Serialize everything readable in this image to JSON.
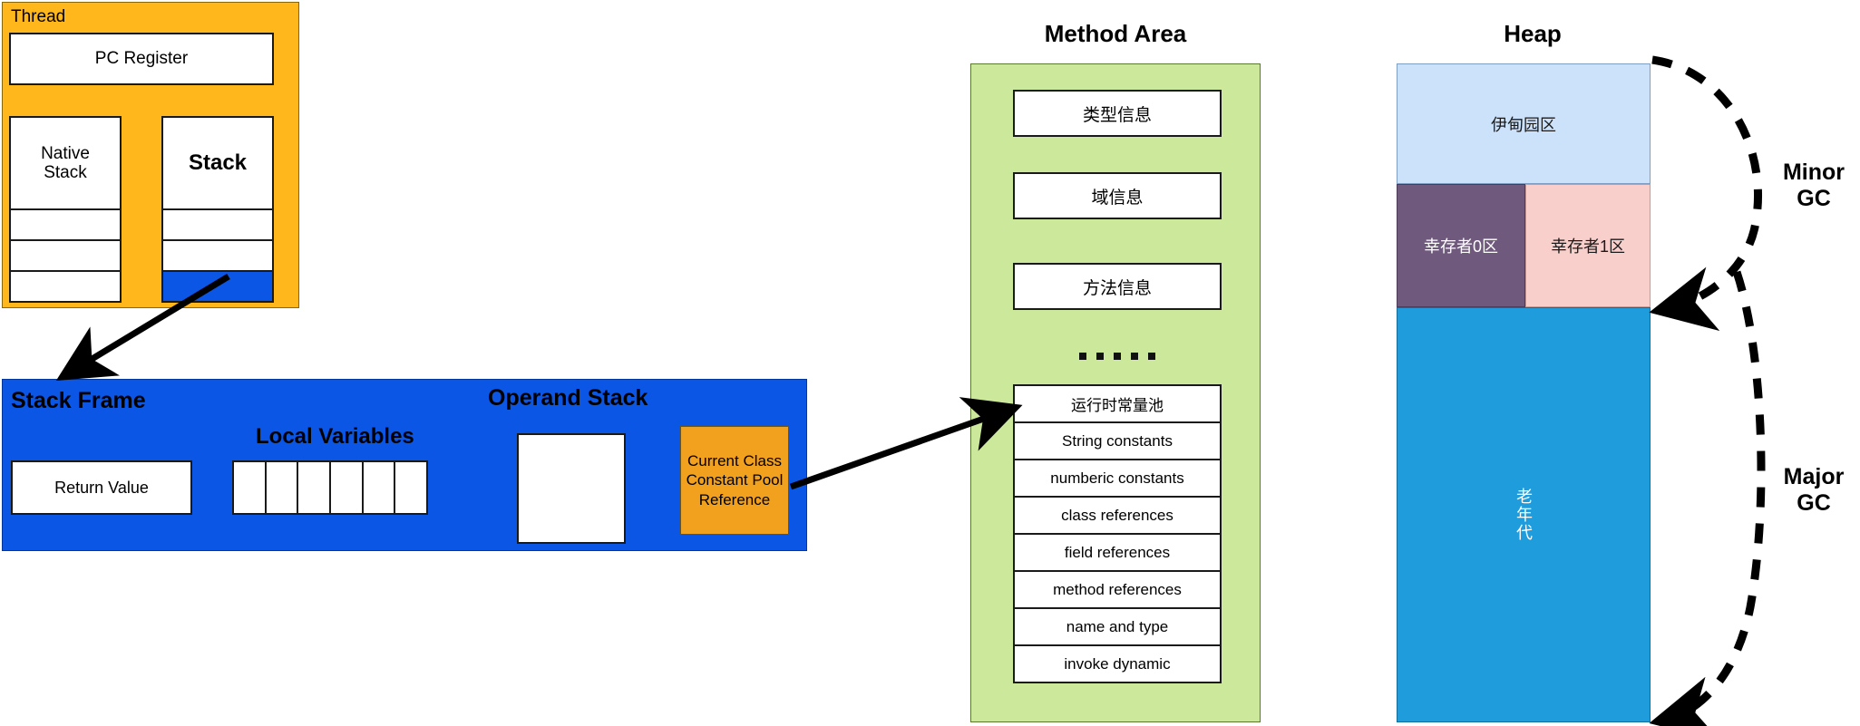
{
  "thread": {
    "label": "Thread",
    "pc_register": "PC Register",
    "native_stack": {
      "head": "Native\nStack",
      "head_line1": "Native",
      "head_line2": "Stack",
      "empty_rows": 3
    },
    "stack": {
      "head": "Stack",
      "empty_rows": 2,
      "highlighted_rows": 1
    }
  },
  "stack_frame": {
    "title": "Stack Frame",
    "local_variables_title": "Local Variables",
    "operand_stack_title": "Operand Stack",
    "return_value": "Return Value",
    "local_variable_slots": 6,
    "constant_pool_reference": "Current Class Constant Pool Reference",
    "constant_pool_reference_lines": [
      "Current Class",
      "Constant Pool",
      "Reference"
    ]
  },
  "method_area": {
    "title": "Method Area",
    "blocks": [
      "类型信息",
      "域信息",
      "方法信息"
    ],
    "separator_dots": 5,
    "runtime_constant_pool": [
      "运行时常量池",
      "String constants",
      "numberic constants",
      "class references",
      "field references",
      "method references",
      "name and type",
      "invoke dynamic"
    ]
  },
  "heap": {
    "title": "Heap",
    "regions": {
      "eden": "伊甸园区",
      "survivor0": "幸存者0区",
      "survivor1": "幸存者1区",
      "old_generation": "老年代"
    },
    "gc_labels": {
      "minor_line1": "Minor",
      "minor_line2": "GC",
      "major_line1": "Major",
      "major_line2": "GC"
    }
  },
  "colors": {
    "thread_orange": "#FFB71B",
    "stack_frame_blue": "#0B56E4",
    "constant_pool_orange": "#F2A11E",
    "method_area_green": "#CCE89B",
    "eden_blue": "#CCE2FA",
    "survivor0_purple": "#6F5A7E",
    "survivor1_pink": "#F8CFCB",
    "old_gen_blue": "#1E9CDB"
  }
}
